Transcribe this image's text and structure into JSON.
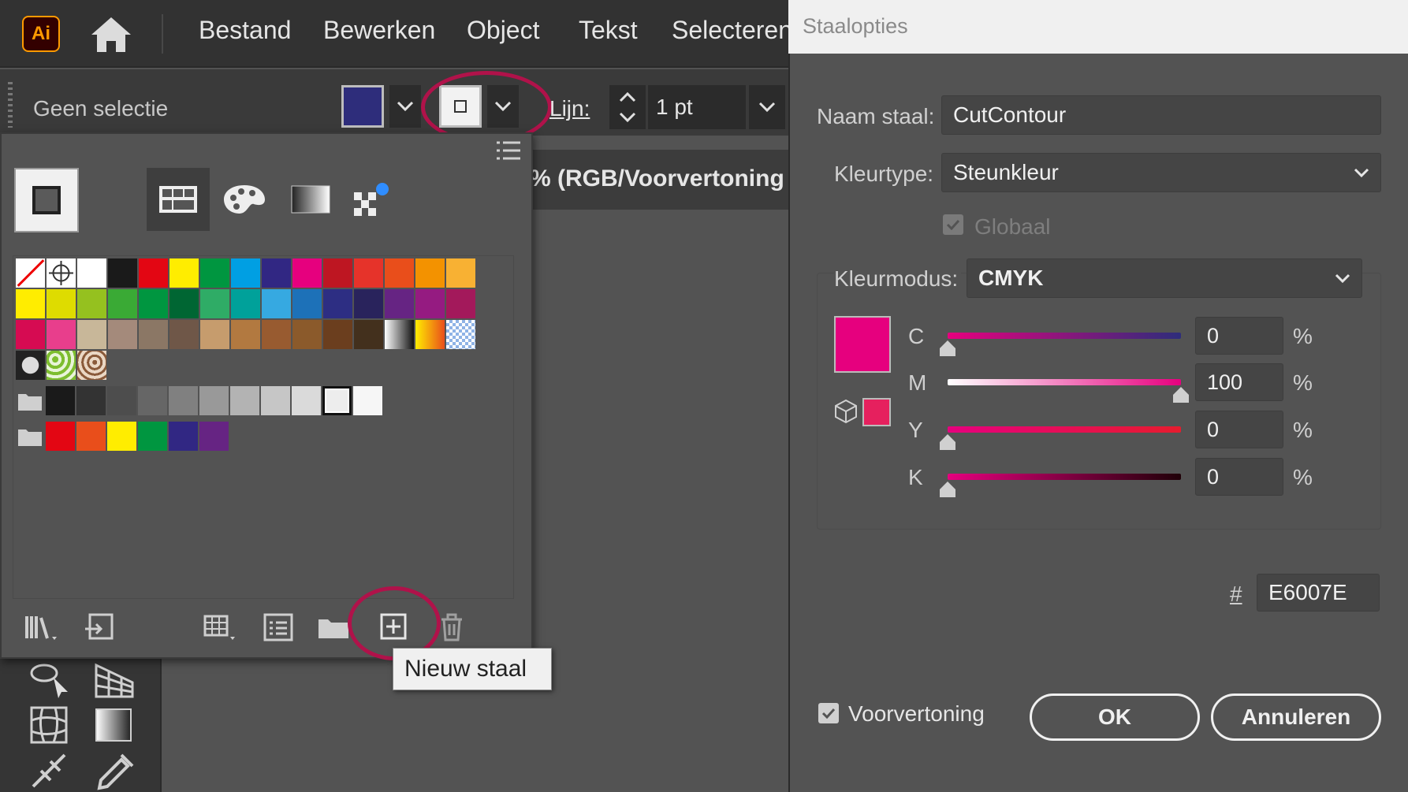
{
  "app": {
    "logo": "Ai",
    "menu": [
      "Bestand",
      "Bewerken",
      "Object",
      "Tekst",
      "Selecteren"
    ]
  },
  "control_bar": {
    "selection_status": "Geen selectie",
    "fill_color": "#2e2d7b",
    "stroke_label": "Lijn:",
    "stroke_weight": "1 pt"
  },
  "document_tab": "% (RGB/Voorvertoning",
  "swatches_panel": {
    "rows": [
      [
        "none",
        "registration",
        "#ffffff",
        "#1a1a1a",
        "#e30613",
        "#ffed00",
        "#009640",
        "#009fe3",
        "#312783",
        "#e6007e",
        "#be1622",
        "#e6332a",
        "#e94e1b",
        "#f39200",
        "#f8b133"
      ],
      [
        "#ffed00",
        "#dedc00",
        "#95c11f",
        "#3aaa35",
        "#009640",
        "#006633",
        "#2fac66",
        "#00a19a",
        "#36a9e1",
        "#1d71b8",
        "#2d2e83",
        "#29235c",
        "#662483",
        "#951b81",
        "#a3195b"
      ],
      [
        "#d60b52",
        "#e83e8c",
        "#c8b799",
        "#a48a7b",
        "#8b7765",
        "#6f5748",
        "#c69c6d",
        "#b27940",
        "#985b30",
        "#8b5a2b",
        "#6b3e1e",
        "#43301d",
        "gradient-bw",
        "gradient-yo",
        "pattern-blue"
      ],
      [
        "pattern-dots",
        "pattern-leaf",
        "pattern-brown"
      ]
    ],
    "gray_group": [
      "#1a1a1a",
      "#333333",
      "#4d4d4d",
      "#666666",
      "#808080",
      "#999999",
      "#b3b3b3",
      "#c6c6c6",
      "#dadada",
      "#ededed-selected",
      "#f6f6f6"
    ],
    "color_group": [
      "#e30613",
      "#e94e1b",
      "#ffed00",
      "#009640",
      "#312783",
      "#662483"
    ],
    "tooltip": "Nieuw staal",
    "highlight_color": "#b0124a"
  },
  "dialog": {
    "title": "Staalopties",
    "name_label": "Naam staal:",
    "name_value": "CutContour",
    "colortype_label": "Kleurtype:",
    "colortype_value": "Steunkleur",
    "global_label": "Globaal",
    "global_checked": true,
    "mode_label": "Kleurmodus:",
    "mode_value": "CMYK",
    "swatch_color": "#e6007e",
    "out_of_gamut_color": "#e6205e",
    "channels": [
      {
        "name": "C",
        "value": "0",
        "unit": "%",
        "level": 0
      },
      {
        "name": "M",
        "value": "100",
        "unit": "%",
        "level": 100
      },
      {
        "name": "Y",
        "value": "0",
        "unit": "%",
        "level": 0
      },
      {
        "name": "K",
        "value": "0",
        "unit": "%",
        "level": 0
      }
    ],
    "hex_label": "#",
    "hex_value": "E6007E",
    "preview_label": "Voorvertoning",
    "preview_checked": true,
    "ok_label": "OK",
    "cancel_label": "Annuleren"
  }
}
